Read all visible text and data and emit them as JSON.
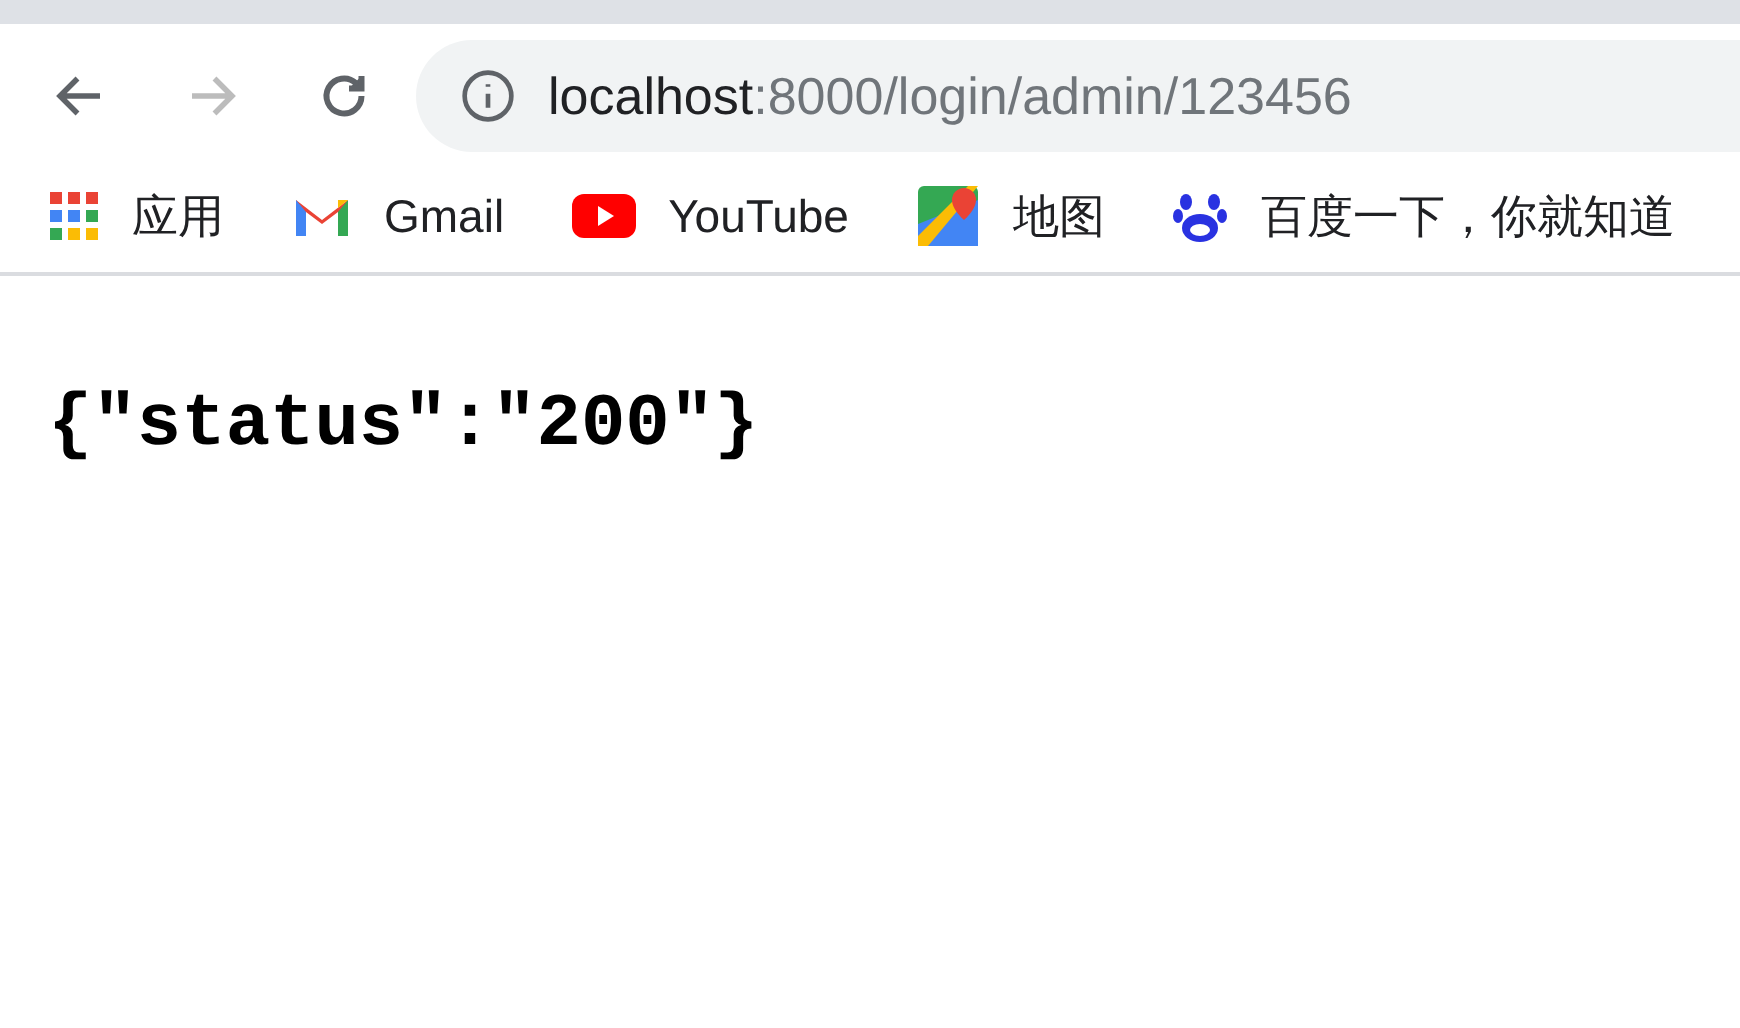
{
  "toolbar": {
    "back": {
      "disabled": false
    },
    "forward": {
      "disabled": true
    },
    "address": {
      "host": "localhost",
      "path": ":8000/login/admin/123456"
    }
  },
  "bookmarks": [
    {
      "kind": "apps",
      "label": "应用"
    },
    {
      "kind": "gmail",
      "label": "Gmail"
    },
    {
      "kind": "youtube",
      "label": "YouTube"
    },
    {
      "kind": "maps",
      "label": "地图"
    },
    {
      "kind": "baidu",
      "label": "百度一下，你就知道"
    }
  ],
  "body": {
    "text": "{\"status\":\"200\"}"
  }
}
